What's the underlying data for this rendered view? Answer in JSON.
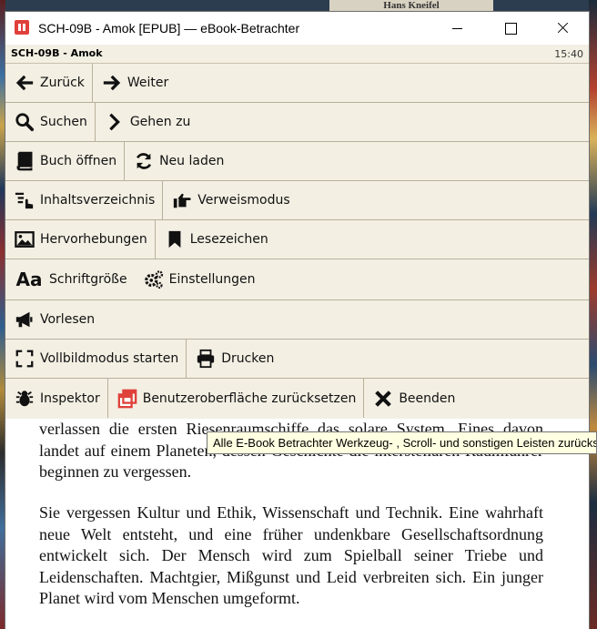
{
  "window": {
    "title": "SCH-09B - Amok [EPUB] — eBook-Betrachter"
  },
  "background": {
    "top_book_text": "Hans Kneifel"
  },
  "header": {
    "book": "SCH-09B - Amok",
    "time": "15:40"
  },
  "menu": {
    "back": "Zurück",
    "forward": "Weiter",
    "search": "Suchen",
    "goto": "Gehen zu",
    "open_book": "Buch öffnen",
    "reload": "Neu laden",
    "toc": "Inhaltsverzeichnis",
    "reference_mode": "Verweismodus",
    "highlights": "Hervorhebungen",
    "bookmarks": "Lesezeichen",
    "font_size": "Schriftgröße",
    "settings": "Einstellungen",
    "read_aloud": "Vorlesen",
    "fullscreen": "Vollbildmodus starten",
    "print": "Drucken",
    "inspector": "Inspektor",
    "reset_ui": "Benutzeroberfläche zurücksetzen",
    "quit": "Beenden"
  },
  "reader": {
    "paragraph_1": "verlassen die ersten Riesenraumschiffe das solare System. Eines davon landet auf einem Planeten, dessen Geschichte die interstellaren Raumfahrer beginnen zu vergessen.",
    "paragraph_2": "Sie vergessen Kultur und Ethik, Wissenschaft und Technik. Eine wahrhaft neue Welt entsteht, und eine früher undenkbare Gesellschaftsordnung entwickelt sich. Der Mensch wird zum Spielball seiner Triebe und Leidenschaften. Machtgier, Mißgunst und Leid verbreiten sich. Ein junger Planet wird vom Menschen umgeformt."
  },
  "tooltip": {
    "text": "Alle E-Book Betrachter Werkzeug- , Scroll- und sonstigen Leisten zurücksetzen"
  },
  "colors": {
    "menu_bg": "#f3efe3",
    "accent_red": "#e0403a"
  }
}
